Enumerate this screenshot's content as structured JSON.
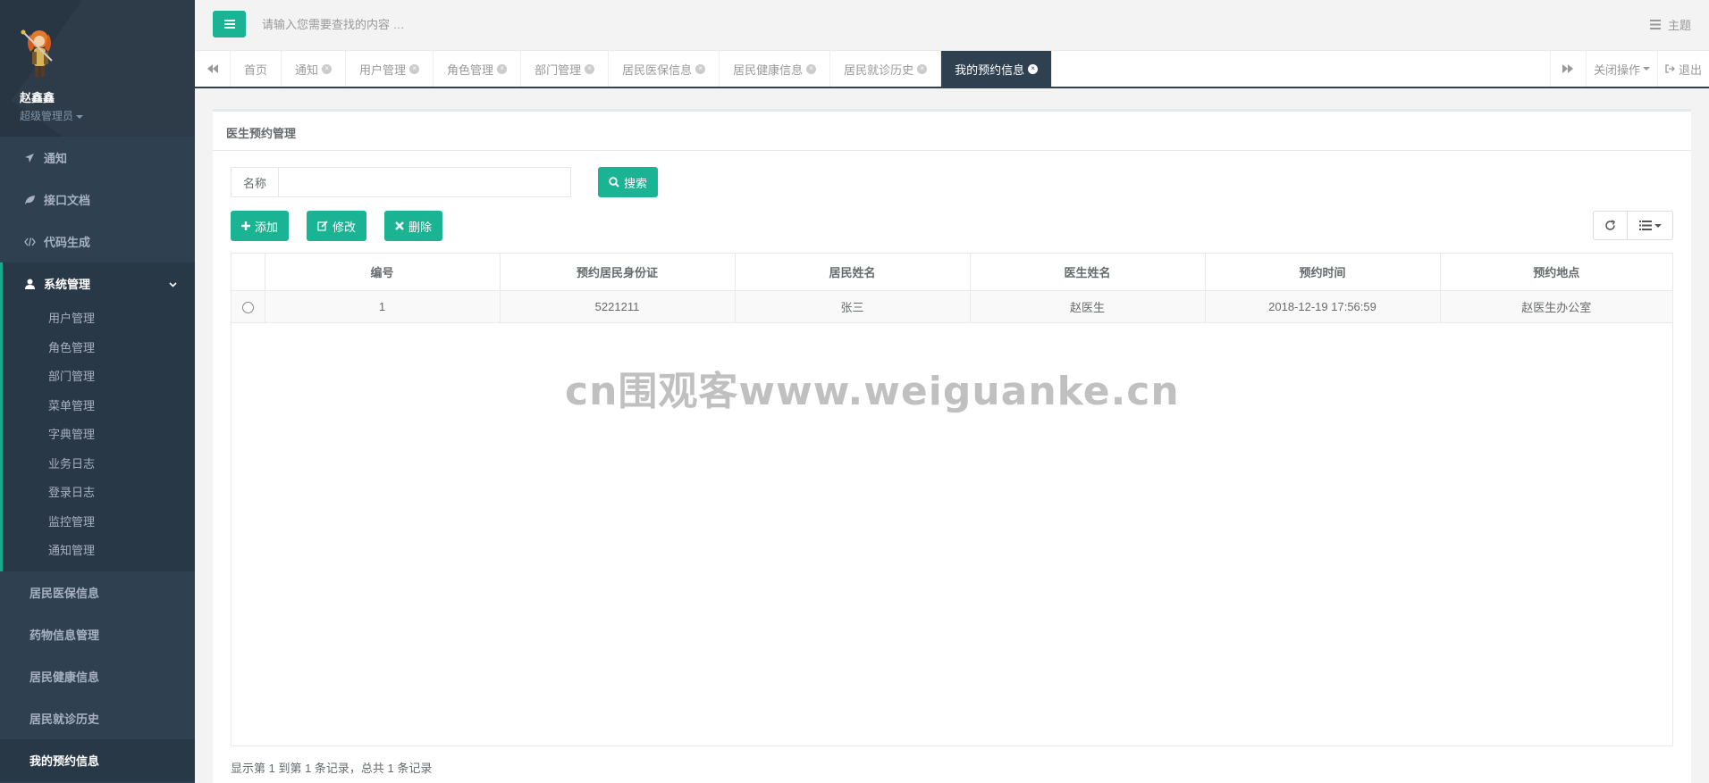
{
  "sidebar": {
    "user_name": "赵鑫鑫",
    "user_role": "超级管理员",
    "menu": [
      {
        "label": "通知",
        "icon": "rocket-icon"
      },
      {
        "label": "接口文档",
        "icon": "leaf-icon"
      },
      {
        "label": "代码生成",
        "icon": "code-icon"
      }
    ],
    "active_group": {
      "label": "系统管理",
      "icon": "user-icon",
      "items": [
        "用户管理",
        "角色管理",
        "部门管理",
        "菜单管理",
        "字典管理",
        "业务日志",
        "登录日志",
        "监控管理",
        "通知管理"
      ]
    },
    "bottom_items": [
      "居民医保信息",
      "药物信息管理",
      "居民健康信息",
      "居民就诊历史",
      "我的预约信息"
    ]
  },
  "topbar": {
    "search_placeholder": "请输入您需要查找的内容 …",
    "theme_label": "主题"
  },
  "tabs": {
    "items": [
      {
        "label": "首页",
        "closable": false
      },
      {
        "label": "通知",
        "closable": true
      },
      {
        "label": "用户管理",
        "closable": true
      },
      {
        "label": "角色管理",
        "closable": true
      },
      {
        "label": "部门管理",
        "closable": true
      },
      {
        "label": "居民医保信息",
        "closable": true
      },
      {
        "label": "居民健康信息",
        "closable": true
      },
      {
        "label": "居民就诊历史",
        "closable": true
      },
      {
        "label": "我的预约信息",
        "closable": true,
        "active": true
      }
    ],
    "close_ops": "关闭操作",
    "logout": "退出"
  },
  "panel": {
    "title": "医生预约管理",
    "name_label": "名称",
    "name_value": "",
    "search_btn": "搜索",
    "add_btn": "添加",
    "edit_btn": "修改",
    "delete_btn": "删除"
  },
  "table": {
    "columns": [
      "编号",
      "预约居民身份证",
      "居民姓名",
      "医生姓名",
      "预约时间",
      "预约地点"
    ],
    "rows": [
      [
        "1",
        "5221211",
        "张三",
        "赵医生",
        "2018-12-19 17:56:59",
        "赵医生办公室"
      ]
    ]
  },
  "footer": {
    "summary": "显示第 1 到第 1 条记录，总共 1 条记录"
  },
  "watermark": "cn围观客www.weiguanke.cn",
  "colors": {
    "sidebar": "#2f4050",
    "accent": "#1ab394"
  }
}
